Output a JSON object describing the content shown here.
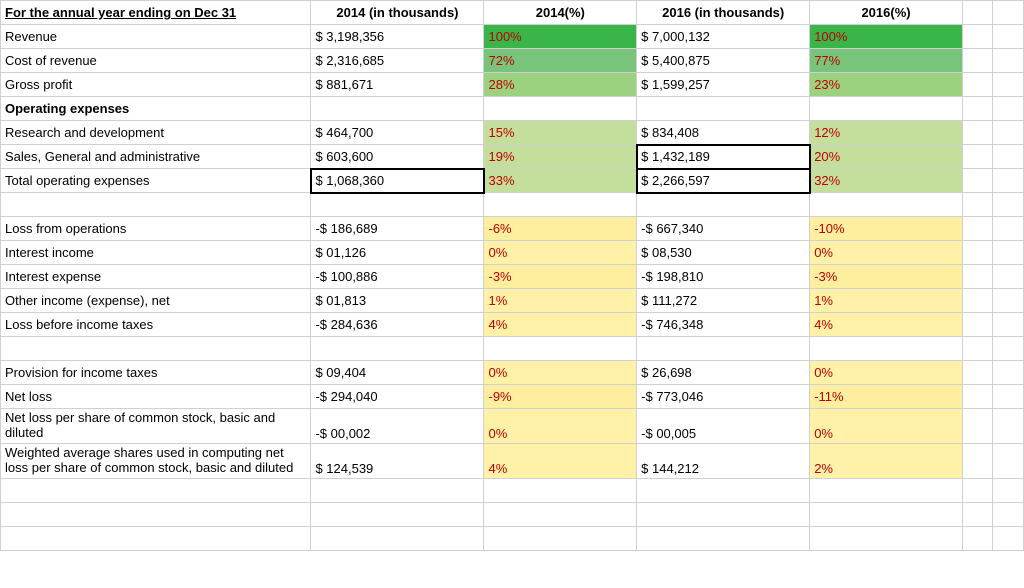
{
  "headers": {
    "label": "For the annual year ending on Dec 31",
    "val2014": "2014 (in thousands)",
    "pct2014": "2014(%)",
    "val2016": "2016 (in thousands)",
    "pct2016": "2016(%)"
  },
  "section_labels": {
    "operating_expenses": "Operating expenses"
  },
  "rows": {
    "revenue": {
      "label": "Revenue",
      "v14": "$ 3,198,356",
      "p14": "100%",
      "v16": "$ 7,000,132",
      "p16": "100%"
    },
    "cor": {
      "label": "Cost of revenue",
      "v14": "$ 2,316,685",
      "p14": "72%",
      "v16": "$ 5,400,875",
      "p16": "77%"
    },
    "gp": {
      "label": "Gross profit",
      "v14": "$ 881,671",
      "p14": "28%",
      "v16": "$ 1,599,257",
      "p16": "23%"
    },
    "rnd": {
      "label": "Research and development",
      "v14": "$ 464,700",
      "p14": "15%",
      "v16": "$ 834,408",
      "p16": "12%"
    },
    "sga": {
      "label": "Sales, General and administrative",
      "v14": "$ 603,600",
      "p14": "19%",
      "v16": "$ 1,432,189",
      "p16": "20%"
    },
    "toe": {
      "label": "Total operating expenses",
      "v14": "$ 1,068,360",
      "p14": "33%",
      "v16": "$ 2,266,597",
      "p16": "32%"
    },
    "lfo": {
      "label": "Loss from operations",
      "v14": "-$ 186,689",
      "p14": "-6%",
      "v16": "-$ 667,340",
      "p16": "-10%"
    },
    "intinc": {
      "label": "Interest income",
      "v14": "$ 01,126",
      "p14": "0%",
      "v16": "$ 08,530",
      "p16": "0%"
    },
    "intexp": {
      "label": "Interest expense",
      "v14": "-$ 100,886",
      "p14": "-3%",
      "v16": "-$ 198,810",
      "p16": "-3%"
    },
    "other": {
      "label": "Other income (expense), net",
      "v14": "$ 01,813",
      "p14": "1%",
      "v16": "$ 111,272",
      "p16": "1%"
    },
    "lbit": {
      "label": "Loss before income taxes",
      "v14": "-$ 284,636",
      "p14": "4%",
      "v16": "-$ 746,348",
      "p16": "4%"
    },
    "prov": {
      "label": "Provision for income taxes",
      "v14": "$ 09,404",
      "p14": "0%",
      "v16": "$ 26,698",
      "p16": "0%"
    },
    "netloss": {
      "label": "Net loss",
      "v14": "-$ 294,040",
      "p14": "-9%",
      "v16": "-$ 773,046",
      "p16": "-11%"
    },
    "nlps": {
      "label": "Net loss per share of common stock, basic and diluted",
      "v14": "-$ 00,002",
      "p14": "0%",
      "v16": "-$ 00,005",
      "p16": "0%"
    },
    "wavg": {
      "label": "Weighted average shares used in computing net loss per share of common stock, basic and diluted",
      "v14": "$ 124,539",
      "p14": "4%",
      "v16": "$ 144,212",
      "p16": "2%"
    }
  }
}
